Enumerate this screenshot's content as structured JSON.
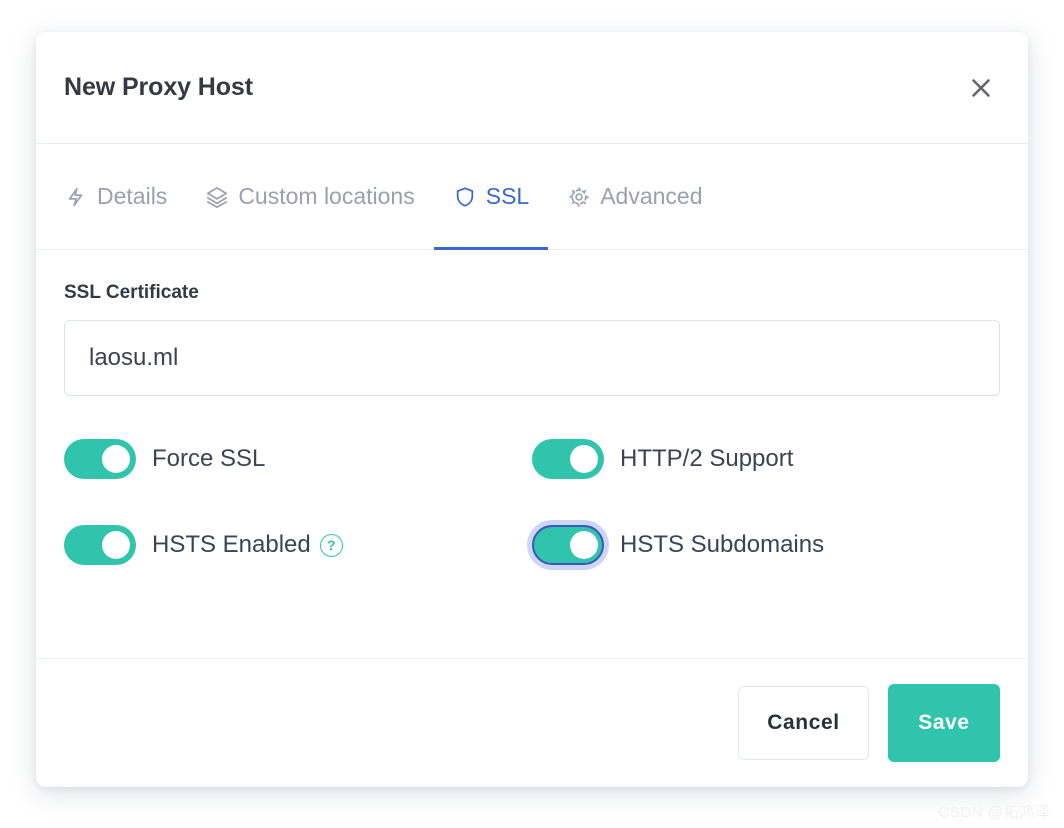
{
  "modal": {
    "title": "New Proxy Host",
    "close_label": "close-icon"
  },
  "tabs": [
    {
      "label": "Details",
      "icon": "bolt-icon",
      "active": false
    },
    {
      "label": "Custom locations",
      "icon": "layers-icon",
      "active": false
    },
    {
      "label": "SSL",
      "icon": "shield-icon",
      "active": true
    },
    {
      "label": "Advanced",
      "icon": "gear-icon",
      "active": false
    }
  ],
  "ssl": {
    "certificate_label": "SSL Certificate",
    "certificate_value": "laosu.ml",
    "toggles": [
      {
        "label": "Force SSL",
        "on": true,
        "focused": false,
        "help": false
      },
      {
        "label": "HTTP/2 Support",
        "on": true,
        "focused": false,
        "help": false
      },
      {
        "label": "HSTS Enabled",
        "on": true,
        "focused": false,
        "help": true,
        "help_glyph": "?"
      },
      {
        "label": "HSTS Subdomains",
        "on": true,
        "focused": true,
        "help": false
      }
    ]
  },
  "footer": {
    "cancel_label": "Cancel",
    "save_label": "Save"
  },
  "watermark": {
    "text": "CSDN @拓鸿泽"
  },
  "colors": {
    "accent_teal": "#2fc4ab",
    "active_tab_blue": "#3b67d0",
    "tab_inactive": "#9aa0b0",
    "text_dark": "#343a40",
    "border": "#e9ecf1",
    "field_border": "#dde1eb",
    "focus_ring": "#3b56c0"
  }
}
